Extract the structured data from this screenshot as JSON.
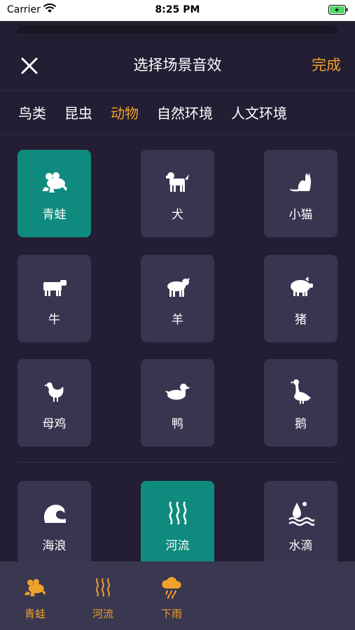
{
  "status": {
    "carrier": "Carrier",
    "time": "8:25 PM"
  },
  "nav": {
    "title": "选择场景音效",
    "done": "完成"
  },
  "tabs": [
    {
      "label": "鸟类",
      "active": false
    },
    {
      "label": "昆虫",
      "active": false
    },
    {
      "label": "动物",
      "active": true
    },
    {
      "label": "自然环境",
      "active": false
    },
    {
      "label": "人文环境",
      "active": false
    }
  ],
  "animals": [
    {
      "label": "青蛙",
      "icon": "frog-icon",
      "selected": true
    },
    {
      "label": "犬",
      "icon": "dog-icon",
      "selected": false
    },
    {
      "label": "小猫",
      "icon": "cat-icon",
      "selected": false
    },
    {
      "label": "牛",
      "icon": "cow-icon",
      "selected": false
    },
    {
      "label": "羊",
      "icon": "sheep-icon",
      "selected": false
    },
    {
      "label": "猪",
      "icon": "pig-icon",
      "selected": false
    },
    {
      "label": "母鸡",
      "icon": "hen-icon",
      "selected": false
    },
    {
      "label": "鸭",
      "icon": "duck-icon",
      "selected": false
    },
    {
      "label": "鹅",
      "icon": "goose-icon",
      "selected": false
    }
  ],
  "nature": [
    {
      "label": "海浪",
      "icon": "wave-icon",
      "selected": false
    },
    {
      "label": "河流",
      "icon": "river-icon",
      "selected": true
    },
    {
      "label": "水滴",
      "icon": "water-drop-icon",
      "selected": false
    }
  ],
  "selected_bar": [
    {
      "label": "青蛙",
      "icon": "frog-icon"
    },
    {
      "label": "河流",
      "icon": "river-icon"
    },
    {
      "label": "下雨",
      "icon": "rain-cloud-icon"
    }
  ],
  "colors": {
    "accent": "#f0a22a",
    "selected_tile": "#0e8b7e",
    "tile": "#3a3450",
    "background": "#231e33"
  }
}
